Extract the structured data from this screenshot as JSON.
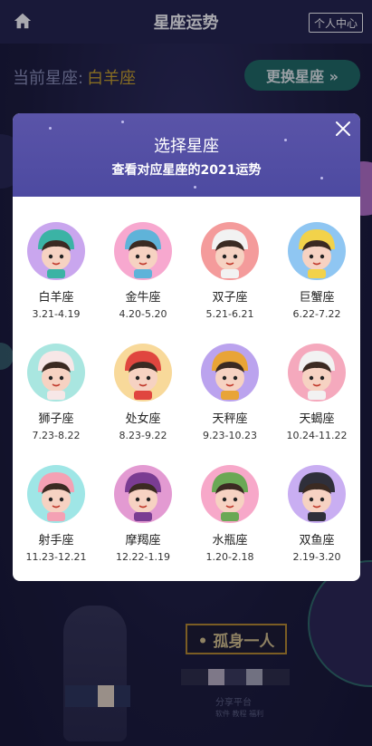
{
  "header": {
    "title": "星座运势",
    "personal_center": "个人中心",
    "home_icon": "home-icon"
  },
  "background": {
    "current_label": "当前星座:",
    "current_value": "白羊座",
    "change_button": "更换星座 »",
    "lonely_label": "• 孤身一人",
    "share_text": "分享平台",
    "share_sub": "软件 教程 福利"
  },
  "modal": {
    "title": "选择星座",
    "subtitle": "查看对应星座的2021运势",
    "close_icon": "close-icon",
    "signs": [
      {
        "name": "白羊座",
        "date": "3.21-4.19",
        "bg": "#c9a6ee",
        "hat": "#3bb3a5",
        "face": "#f6d2c2"
      },
      {
        "name": "金牛座",
        "date": "4.20-5.20",
        "bg": "#f7a8cf",
        "hat": "#5fb3d9",
        "face": "#f6d2c2"
      },
      {
        "name": "双子座",
        "date": "5.21-6.21",
        "bg": "#f49b9b",
        "hat": "#f2f2f2",
        "face": "#f6d2c2"
      },
      {
        "name": "巨蟹座",
        "date": "6.22-7.22",
        "bg": "#8fc6f2",
        "hat": "#f2d24a",
        "face": "#f6d2c2"
      },
      {
        "name": "狮子座",
        "date": "7.23-8.22",
        "bg": "#a9e6e0",
        "hat": "#f7e7e7",
        "face": "#f6d2c2"
      },
      {
        "name": "处女座",
        "date": "8.23-9.22",
        "bg": "#f8d99a",
        "hat": "#e0463f",
        "face": "#f6d2c2"
      },
      {
        "name": "天秤座",
        "date": "9.23-10.23",
        "bg": "#bba3ee",
        "hat": "#e8a437",
        "face": "#f6d2c2"
      },
      {
        "name": "天蝎座",
        "date": "10.24-11.22",
        "bg": "#f5a9bd",
        "hat": "#f2f2f2",
        "face": "#f6d2c2"
      },
      {
        "name": "射手座",
        "date": "11.23-12.21",
        "bg": "#9fe6e6",
        "hat": "#f4a1b4",
        "face": "#f6d2c2"
      },
      {
        "name": "摩羯座",
        "date": "12.22-1.19",
        "bg": "#e39ad2",
        "hat": "#7a3c92",
        "face": "#f6d2c2"
      },
      {
        "name": "水瓶座",
        "date": "1.20-2.18",
        "bg": "#f7a8c9",
        "hat": "#6aa855",
        "face": "#f6d2c2"
      },
      {
        "name": "双鱼座",
        "date": "2.19-3.20",
        "bg": "#c9aef2",
        "hat": "#2f2f3a",
        "face": "#f6d2c2"
      }
    ]
  },
  "colors": {
    "header_bg": "#23224a",
    "modal_head": "#5a54a8",
    "accent_gold": "#c9a227",
    "change_btn": "#1e6b62"
  }
}
